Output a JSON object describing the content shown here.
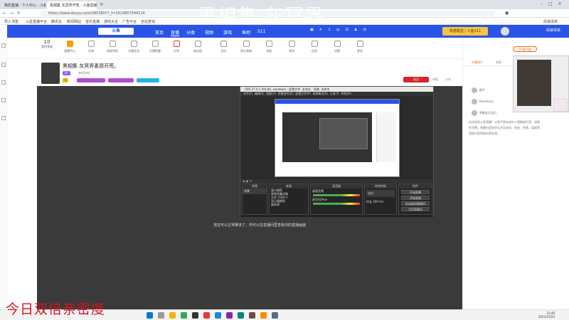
{
  "browser": {
    "tabs": [
      {
        "label": "我的直播 - 个人中心 - 斗鱼",
        "active": false
      },
      {
        "label": "黑相集 灰冥界开荒 - 斗鱼直播",
        "active": true
      }
    ],
    "url": "https://www.douyu.com/3851807?_t=1614807544114",
    "bookmarks": [
      "导入书签",
      "火星直播平台",
      "腾讯云",
      "新闻网站",
      "音乐直播",
      "游戏大全",
      "广告平台",
      "全站查询"
    ],
    "reading_list": "阅读清单"
  },
  "site": {
    "logo": "斗鱼",
    "nav": [
      "首页",
      "直播",
      "分类",
      "视频",
      "游戏",
      "鱼吧",
      "S11"
    ],
    "promo": "英雄联盟 / 斗鱼S11"
  },
  "categories": [
    {
      "count": "10",
      "label": "我的等级"
    },
    {
      "label": "直播中心"
    },
    {
      "label": "礼物"
    },
    {
      "label": "贵族特权"
    },
    {
      "label": "主播任务"
    },
    {
      "label": "开播提醒"
    },
    {
      "label": "分享"
    },
    {
      "label": "粉丝团"
    },
    {
      "label": "活动"
    },
    {
      "label": "鱼丸商城"
    },
    {
      "label": "充值"
    },
    {
      "label": "背包"
    },
    {
      "label": "任务"
    },
    {
      "label": "设置"
    },
    {
      "label": "更多"
    }
  ],
  "streamer": {
    "title": "黑相集 灰冥界素质开荒。",
    "category": "单机游戏",
    "level": "LV",
    "follow_button": "关注",
    "report": "举报",
    "share": "分享"
  },
  "obs": {
    "title": "OBS 27.0.1 (64-bit, windows) - 配置文件: 未命名 - 场景: 未命名",
    "menu": [
      "文件(F)",
      "编辑(E)",
      "视图(V)",
      "停靠部件(D)",
      "配置文件(P)",
      "场景集合(S)",
      "工具(T)",
      "帮助(H)"
    ],
    "docks": [
      {
        "title": "场景",
        "items": [
          "场景"
        ]
      },
      {
        "title": "来源",
        "items": [
          "窗口捕获",
          "视频采集设备",
          "文本 (GDI+)",
          "显示器捕获",
          "媒体源"
        ]
      },
      {
        "title": "混音器",
        "items": [
          "桌面音频",
          "麦克风/Aux"
        ]
      },
      {
        "title": "转场特效",
        "items": [
          "淡出",
          "时长 300 ms"
        ]
      },
      {
        "title": "控件",
        "items": [
          "开始直播",
          "开始录制",
          "启动虚拟摄像机",
          "工作室模式",
          "设置",
          "退出"
        ]
      }
    ],
    "status": "LIVE: 00:00:00   REC: 00:00:00   CPU: 2.1%, 30.00 fps"
  },
  "video_caption": "流在可以正常推流了，你可以在直播间里查看你的直播画面",
  "sidebar": {
    "gift_badge": "PC客户端",
    "tabs": [
      "主播排行",
      "贵宾"
    ],
    "rank": [
      {
        "name": "橙子"
      },
      {
        "name": "Rosemary"
      },
      {
        "name": "余额宝大宝贝"
      }
    ],
    "notice": "欢迎来到斗鱼直播！斗鱼严禁未成年人直播或打赏，请理性消费。直播内容和评论涉及政治、低俗、色情、吸烟等违规内容将被封禁处理。"
  },
  "taskbar": {
    "time": "22:46",
    "date": "2021/10/23"
  },
  "watermarks": {
    "top": "黑相集 灰冥界",
    "bottom": "今日双倍亲密度"
  }
}
